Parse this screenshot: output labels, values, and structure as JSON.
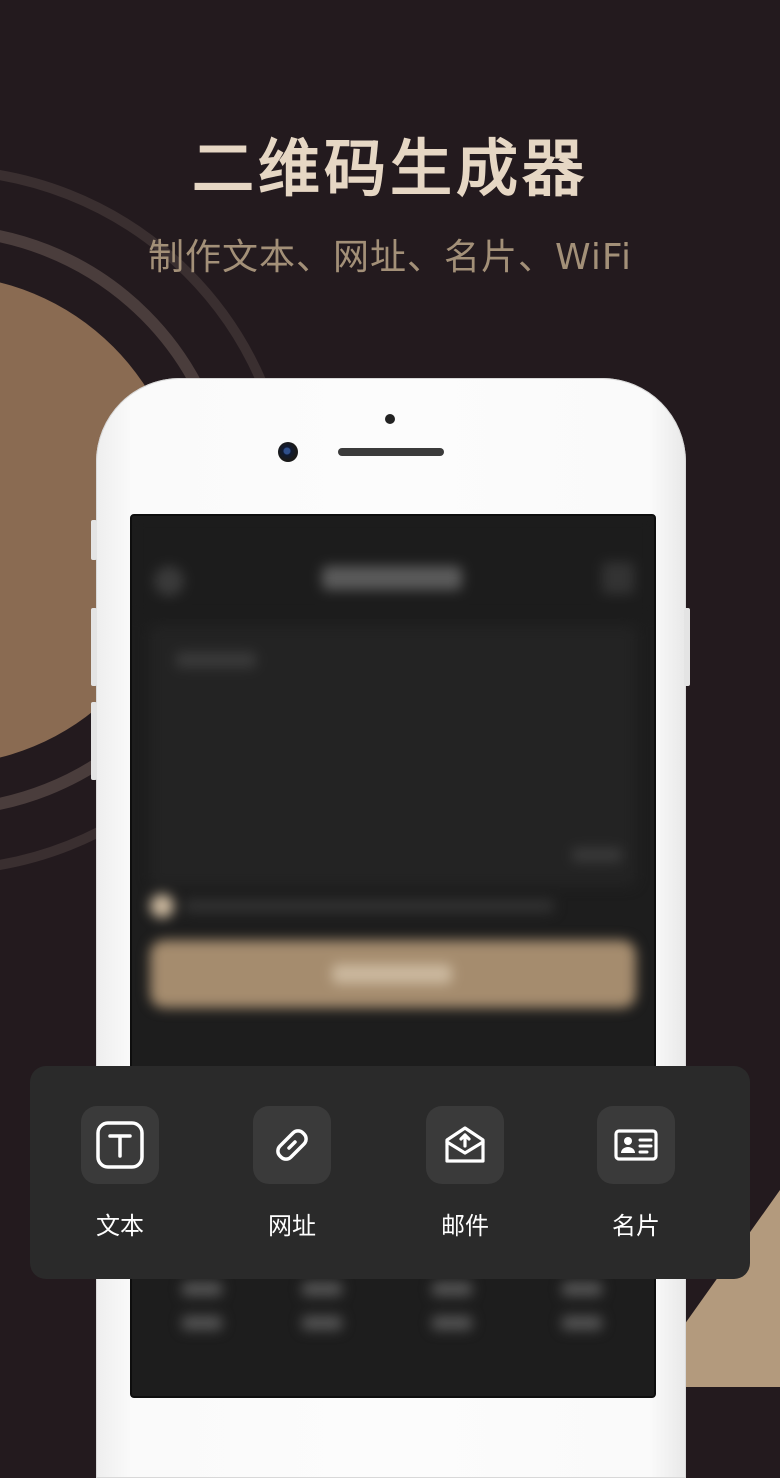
{
  "header": {
    "title": "二维码生成器",
    "subtitle": "制作文本、网址、名片、WiFi"
  },
  "panel": {
    "items": [
      {
        "label": "文本",
        "icon": "text-icon"
      },
      {
        "label": "网址",
        "icon": "link-icon"
      },
      {
        "label": "邮件",
        "icon": "mail-icon"
      },
      {
        "label": "名片",
        "icon": "business-card-icon"
      }
    ]
  },
  "colors": {
    "background": "#231a1e",
    "accent": "#a58c6e",
    "title": "#e6d7c4",
    "panel": "#2a2a2a"
  }
}
